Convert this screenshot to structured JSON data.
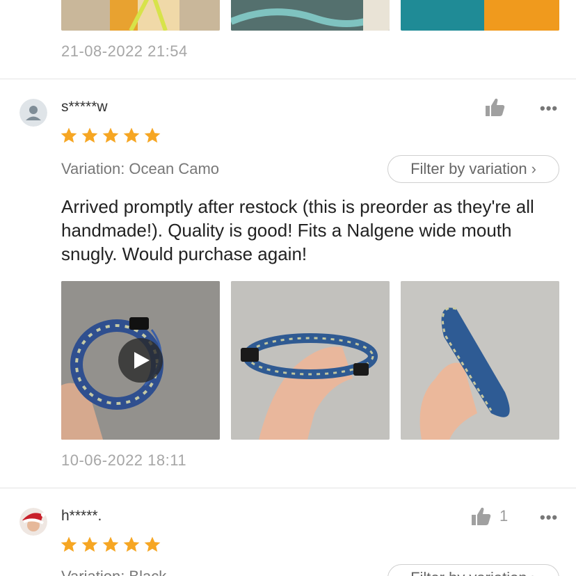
{
  "previous_review": {
    "timestamp": "21-08-2022 21:54",
    "thumbnails": [
      "review-photo",
      "review-photo",
      "review-photo"
    ]
  },
  "review1": {
    "username": "s*****w",
    "rating": 5,
    "variation": "Variation: Ocean Camo",
    "filter_label": "Filter by variation",
    "text": "Arrived promptly after restock (this is preorder as they're all handmade!). Quality is good! Fits a Nalgene wide mouth snugly. Would purchase again!",
    "media": [
      {
        "kind": "video",
        "icon": "play-icon"
      },
      {
        "kind": "photo"
      },
      {
        "kind": "photo"
      }
    ],
    "timestamp": "10-06-2022 18:11",
    "like_icon": "thumbs-up-icon",
    "more_label": "•••"
  },
  "review2": {
    "username": "h*****.",
    "rating": 5,
    "likes": "1",
    "variation": "Variation: Black",
    "filter_label": "Filter by variation",
    "more_label": "•••"
  },
  "colors": {
    "star": "#f6a623",
    "muted_text": "#a6a6a6",
    "divider": "#e4e4e4"
  }
}
